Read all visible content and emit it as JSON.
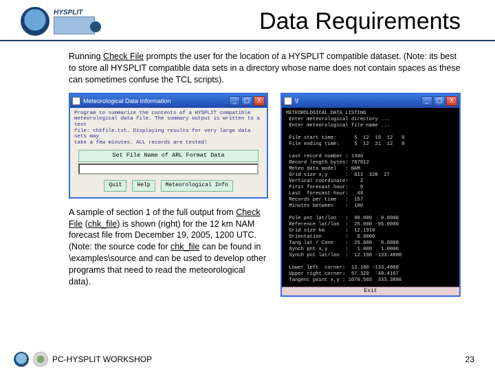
{
  "header": {
    "badge_text": "HYSPLIT",
    "title": "Data Requirements"
  },
  "para1": {
    "lead": "Running ",
    "u1": "Check File",
    "rest": " prompts the user for the location of a HYSPLIT compatible dataset. (Note: its best to store all HYSPLIT compatible data sets in a directory whose name does not contain spaces as these can sometimes confuse the TCL scripts)."
  },
  "meta_win": {
    "title": "Meteorological Data Information",
    "prog_lines": "Program to summarize the contents of a HYSPLIT compatible\nmeteorological data file. The summary output is written to a text\nfile: chkfile.txt. Displaying results for very large data sets may\ntake a few minutes. ALL records are tested!",
    "panel_label": "Set File Name of ARL Format Data",
    "buttons": {
      "quit": "Quit",
      "help": "Help",
      "run": "Meteorological Info"
    }
  },
  "para2": {
    "a": "A sample of section 1 of the full output from ",
    "u1": "Check File",
    "b": " (",
    "u2": "chk_file",
    "c": ") is shown (right) for the 12 km NAM forecast file from December 19, 2005, 1200 UTC. (Note: the source code for ",
    "u3": "chk_file",
    "d": " can be found in \\examples\\source and can be used to develop other programs that need to read the meteorological data)."
  },
  "cmd": {
    "title": "\\f",
    "body": "METEOROLOGICAL DATA LISTING\n Enter meteorological directory ...\n Enter meteorological file name ...\n\n File start time:      5  12  19  12   0\n File ending time:     5  12  21  12   0\n\n Last record number : 1340\n Record length bytes: 707812\n Meteo data model   : NAM\n Grid size x,y      :  611  328  27\n Vertical coordinate:    2\n First forecast hour:    0\n Last  forecast hour:   48\n Records per time   :  157\n Minutes between    :  180\n\n Pole pnt lat/lon   :  90.000   0.0000\n Reference lat/lon  :  25.000 -95.0000\n Grid size km       :  12.1910\n Orientation        :   0.0000\n Tang lat / Cone    :  25.000   0.0000\n Synch pnt x,y      :   1.000   1.0000\n Synch pnt lat/lon  :  12.190 -133.4800\n\n Lower left  corner:  12.190 -133.4800\n Upper right corner:  57.320  -49.4167\n Tangent point x,y : 1070.565  333.3886",
    "exit": "Exit"
  },
  "footer": {
    "workshop": "PC-HYSPLIT WORKSHOP",
    "page": "23"
  }
}
